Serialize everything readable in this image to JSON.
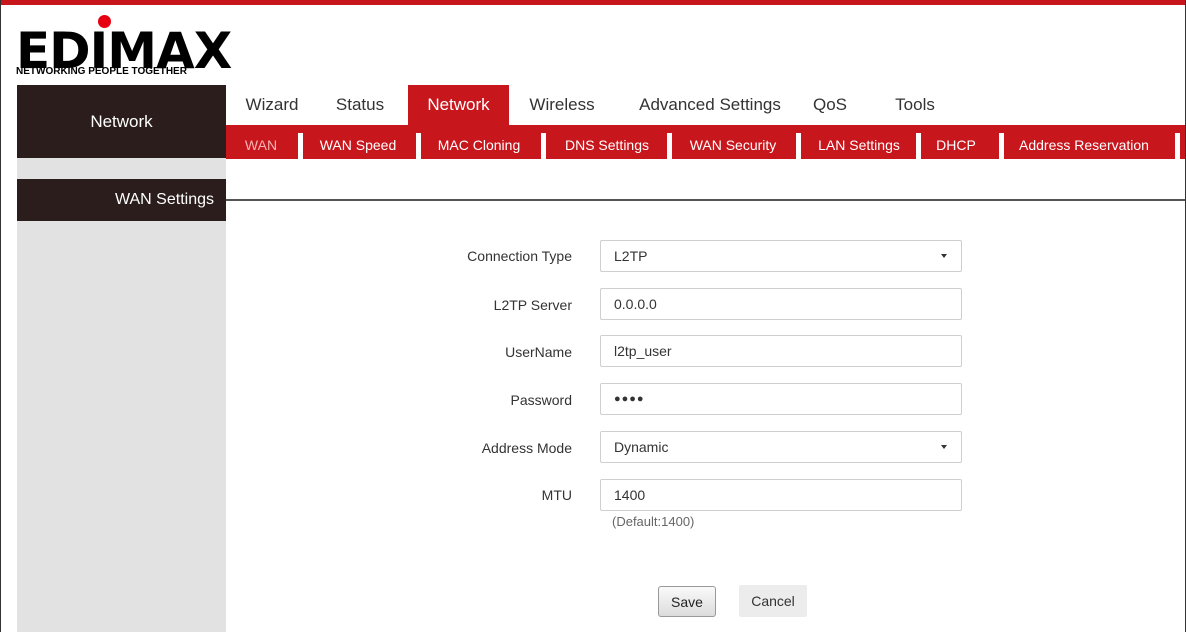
{
  "logo": {
    "wordmark": "EDIMAX",
    "tagline": "NETWORKING PEOPLE TOGETHER",
    "accent": "#e60012"
  },
  "sidebar": {
    "section_title": "Network",
    "items": [
      {
        "label": "WAN Settings"
      }
    ]
  },
  "main_tabs": [
    {
      "label": "Wizard"
    },
    {
      "label": "Status"
    },
    {
      "label": "Network",
      "active": true
    },
    {
      "label": "Wireless"
    },
    {
      "label": "Advanced Settings"
    },
    {
      "label": "QoS"
    },
    {
      "label": "Tools"
    }
  ],
  "sub_tabs": [
    {
      "label": "WAN",
      "active": true
    },
    {
      "label": "WAN Speed"
    },
    {
      "label": "MAC Cloning"
    },
    {
      "label": "DNS Settings"
    },
    {
      "label": "WAN Security"
    },
    {
      "label": "LAN Settings"
    },
    {
      "label": "DHCP"
    },
    {
      "label": "Address Reservation"
    }
  ],
  "form": {
    "connection_type": {
      "label": "Connection Type",
      "value": "L2TP"
    },
    "l2tp_server": {
      "label": "L2TP Server",
      "value": "0.0.0.0"
    },
    "username": {
      "label": "UserName",
      "value": "l2tp_user"
    },
    "password": {
      "label": "Password",
      "value": "●●●●"
    },
    "address_mode": {
      "label": "Address Mode",
      "value": "Dynamic"
    },
    "mtu": {
      "label": "MTU",
      "value": "1400",
      "hint": "(Default:1400)"
    }
  },
  "buttons": {
    "save": "Save",
    "cancel": "Cancel"
  },
  "colors": {
    "brand_red": "#c8161d",
    "dark": "#2b1d1c",
    "sidebar_bg": "#e2e2e2"
  }
}
